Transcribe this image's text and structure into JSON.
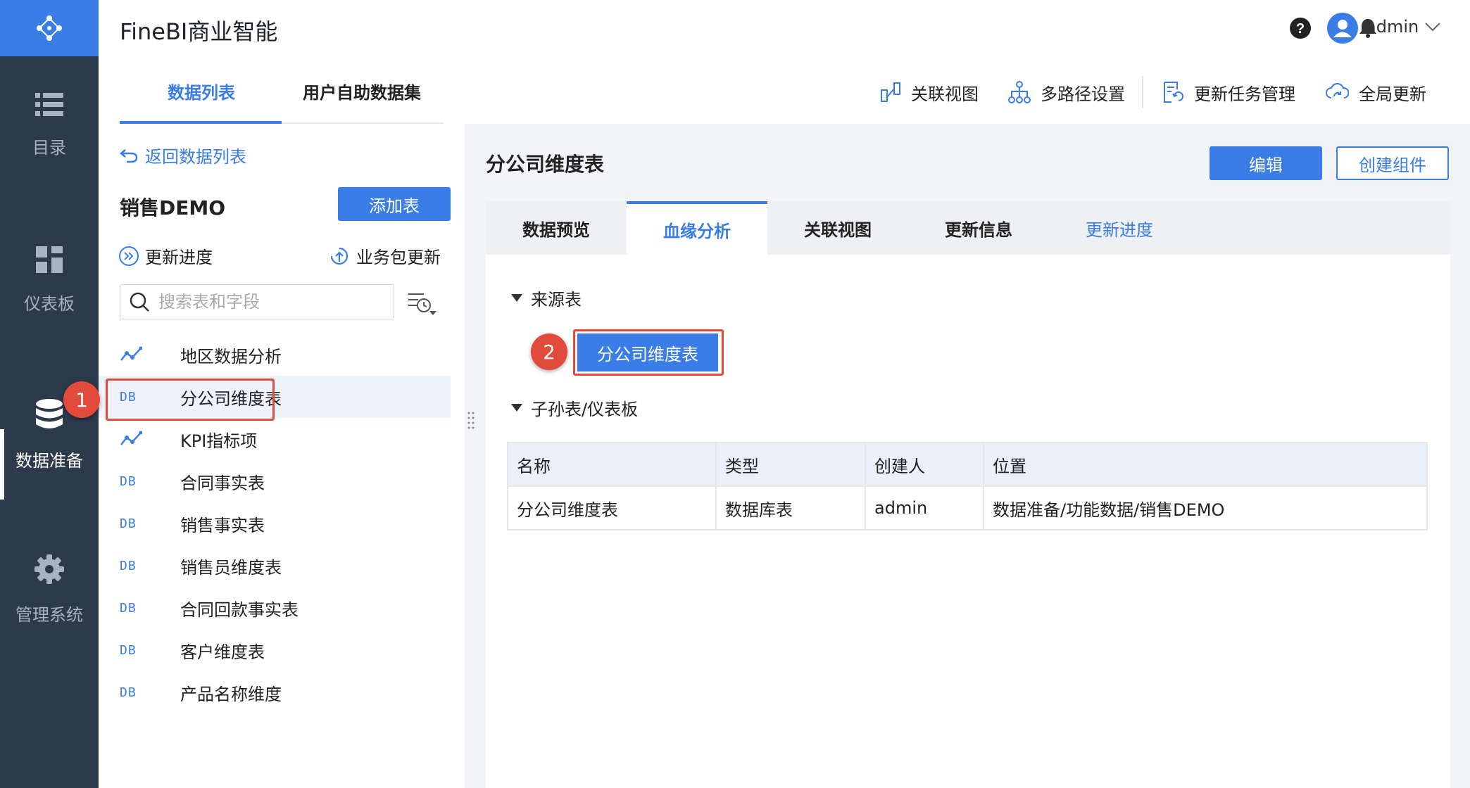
{
  "app": {
    "title": "FineBI商业智能"
  },
  "sidebar": {
    "items": [
      {
        "label": "目录",
        "icon": "list-icon"
      },
      {
        "label": "仪表板",
        "icon": "dashboard-grid-icon"
      },
      {
        "label": "数据准备",
        "icon": "database-icon",
        "active": true
      },
      {
        "label": "管理系统",
        "icon": "gear-icon"
      }
    ]
  },
  "header": {
    "user": "admin"
  },
  "left": {
    "tabs": [
      {
        "label": "数据列表",
        "active": true
      },
      {
        "label": "用户自助数据集"
      }
    ],
    "back_label": "返回数据列表",
    "package_title": "销售DEMO",
    "add_table_label": "添加表",
    "update_progress_label": "更新进度",
    "package_update_label": "业务包更新",
    "search_placeholder": "搜索表和字段",
    "tables": [
      {
        "name": "地区数据分析",
        "icon": "analysis-line-icon"
      },
      {
        "name": "分公司维度表",
        "icon": "db-icon",
        "icon_text": "DB",
        "selected": true
      },
      {
        "name": "KPI指标项",
        "icon": "analysis-line-icon"
      },
      {
        "name": "合同事实表",
        "icon": "db-icon",
        "icon_text": "DB"
      },
      {
        "name": "销售事实表",
        "icon": "db-icon",
        "icon_text": "DB"
      },
      {
        "name": "销售员维度表",
        "icon": "db-icon",
        "icon_text": "DB"
      },
      {
        "name": "合同回款事实表",
        "icon": "db-icon",
        "icon_text": "DB"
      },
      {
        "name": "客户维度表",
        "icon": "db-icon",
        "icon_text": "DB"
      },
      {
        "name": "产品名称维度",
        "icon": "db-icon",
        "icon_text": "DB"
      }
    ]
  },
  "annotations": {
    "badge1": "1",
    "badge2": "2"
  },
  "toolbar": {
    "items": [
      {
        "label": "关联视图",
        "icon": "relation-view-icon"
      },
      {
        "label": "多路径设置",
        "icon": "multipath-icon"
      },
      {
        "label": "更新任务管理",
        "icon": "task-manage-icon"
      },
      {
        "label": "全局更新",
        "icon": "cloud-refresh-icon"
      }
    ]
  },
  "detail": {
    "title": "分公司维度表",
    "edit_label": "编辑",
    "create_component_label": "创建组件",
    "tabs": [
      {
        "label": "数据预览"
      },
      {
        "label": "血缘分析",
        "active": true
      },
      {
        "label": "关联视图"
      },
      {
        "label": "更新信息"
      },
      {
        "label": "更新进度",
        "style": "link"
      }
    ],
    "source_section": "来源表",
    "source_table": "分公司维度表",
    "child_section": "子孙表/仪表板",
    "table": {
      "headers": [
        "名称",
        "类型",
        "创建人",
        "位置"
      ],
      "rows": [
        [
          "分公司维度表",
          "数据库表",
          "admin",
          "数据准备/功能数据/销售DEMO"
        ]
      ]
    }
  },
  "colors": {
    "accent": "#3a7de6",
    "sidebar_bg": "#2d3a4b",
    "annotation_red": "#e24a3b"
  }
}
